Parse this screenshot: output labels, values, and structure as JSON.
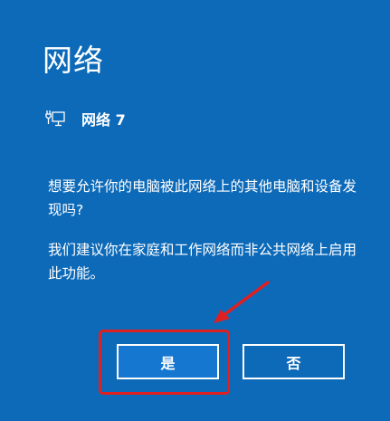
{
  "flyout": {
    "title": "网络",
    "network_name": "网络 7",
    "paragraph1": "想要允许你的电脑被此网络上的其他电脑和设备发现吗?",
    "paragraph2": "我们建议你在家庭和工作网络而非公共网络上启用此功能。",
    "yes_label": "是",
    "no_label": "否",
    "network_icon": "ethernet-monitor-icon"
  },
  "colors": {
    "background": "#0d6ab8",
    "yes_button": "#1577d0",
    "annotation": "#e02020"
  }
}
